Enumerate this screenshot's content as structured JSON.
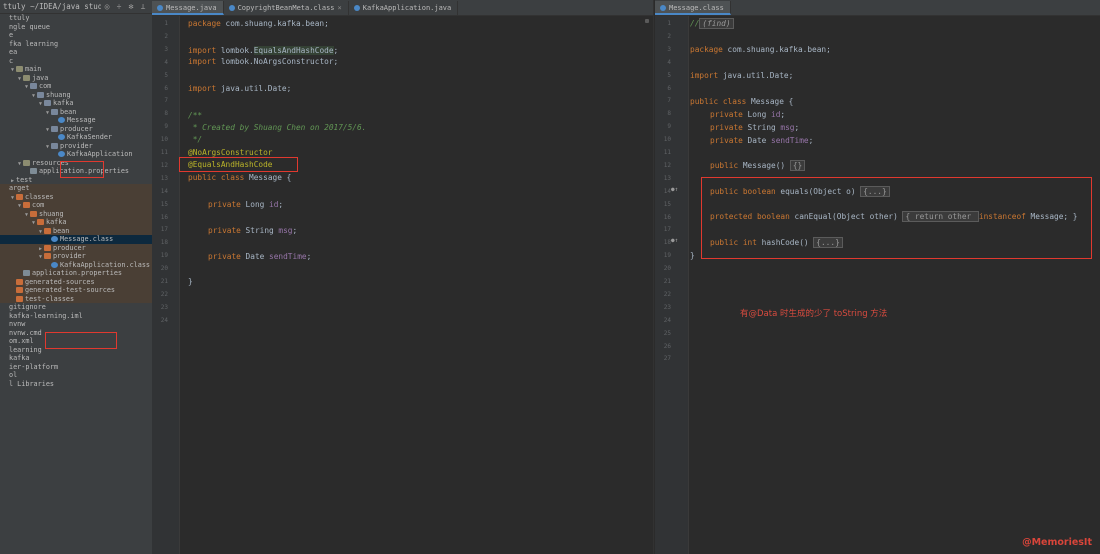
{
  "sidebar": {
    "title": "ttuly ~/IDEA/java study",
    "icons": [
      "globe-icon",
      "divide-icon",
      "gear-icon",
      "minimize-icon"
    ],
    "tree": [
      {
        "label": "ttuly",
        "depth": 0,
        "arrow": "",
        "icon": "",
        "band": false
      },
      {
        "label": "ngle queue",
        "depth": 0,
        "arrow": "",
        "icon": "",
        "band": false
      },
      {
        "label": "e",
        "depth": 0,
        "arrow": "",
        "icon": "",
        "band": false
      },
      {
        "label": "fka learning",
        "depth": 0,
        "arrow": "",
        "icon": "",
        "band": false
      },
      {
        "label": "ea",
        "depth": 0,
        "arrow": "",
        "icon": "",
        "band": false
      },
      {
        "label": "c",
        "depth": 0,
        "arrow": "",
        "icon": "",
        "band": false
      },
      {
        "label": "main",
        "depth": 1,
        "arrow": "▼",
        "icon": "folder",
        "band": false
      },
      {
        "label": "java",
        "depth": 2,
        "arrow": "▼",
        "icon": "folder",
        "band": false
      },
      {
        "label": "com",
        "depth": 3,
        "arrow": "▼",
        "icon": "pkg",
        "band": false
      },
      {
        "label": "shuang",
        "depth": 4,
        "arrow": "▼",
        "icon": "pkg",
        "band": false
      },
      {
        "label": "kafka",
        "depth": 5,
        "arrow": "▼",
        "icon": "pkg",
        "band": false
      },
      {
        "label": "bean",
        "depth": 6,
        "arrow": "▼",
        "icon": "pkg",
        "band": false
      },
      {
        "label": "Message",
        "depth": 7,
        "arrow": "",
        "icon": "class",
        "band": false
      },
      {
        "label": "producer",
        "depth": 6,
        "arrow": "▼",
        "icon": "pkg",
        "band": false
      },
      {
        "label": "KafkaSender",
        "depth": 7,
        "arrow": "",
        "icon": "class",
        "band": false
      },
      {
        "label": "provider",
        "depth": 6,
        "arrow": "▼",
        "icon": "pkg",
        "band": false
      },
      {
        "label": "KafkaApplication",
        "depth": 7,
        "arrow": "",
        "icon": "class",
        "band": false
      },
      {
        "label": "resources",
        "depth": 2,
        "arrow": "▼",
        "icon": "folder",
        "band": false
      },
      {
        "label": "application.properties",
        "depth": 3,
        "arrow": "",
        "icon": "file",
        "band": false
      },
      {
        "label": "test",
        "depth": 1,
        "arrow": "▶",
        "icon": "",
        "band": false
      },
      {
        "label": "arget",
        "depth": 0,
        "arrow": "",
        "icon": "",
        "band": true
      },
      {
        "label": "classes",
        "depth": 1,
        "arrow": "▼",
        "icon": "out",
        "band": true
      },
      {
        "label": "com",
        "depth": 2,
        "arrow": "▼",
        "icon": "out",
        "band": true
      },
      {
        "label": "shuang",
        "depth": 3,
        "arrow": "▼",
        "icon": "out",
        "band": true
      },
      {
        "label": "kafka",
        "depth": 4,
        "arrow": "▼",
        "icon": "out",
        "band": true
      },
      {
        "label": "bean",
        "depth": 5,
        "arrow": "▼",
        "icon": "out",
        "band": true
      },
      {
        "label": "Message.class",
        "depth": 6,
        "arrow": "",
        "icon": "class",
        "band": true,
        "selected": true
      },
      {
        "label": "producer",
        "depth": 5,
        "arrow": "▶",
        "icon": "out",
        "band": true
      },
      {
        "label": "provider",
        "depth": 5,
        "arrow": "▼",
        "icon": "out",
        "band": true
      },
      {
        "label": "KafkaApplication.class",
        "depth": 6,
        "arrow": "",
        "icon": "class",
        "band": true
      },
      {
        "label": "application.properties",
        "depth": 2,
        "arrow": "",
        "icon": "file",
        "band": true
      },
      {
        "label": "generated-sources",
        "depth": 1,
        "arrow": "",
        "icon": "out",
        "band": true
      },
      {
        "label": "generated-test-sources",
        "depth": 1,
        "arrow": "",
        "icon": "out",
        "band": true
      },
      {
        "label": "test-classes",
        "depth": 1,
        "arrow": "",
        "icon": "out",
        "band": true
      },
      {
        "label": "gitignore",
        "depth": 0,
        "arrow": "",
        "icon": "",
        "band": false
      },
      {
        "label": "kafka-learning.iml",
        "depth": 0,
        "arrow": "",
        "icon": "",
        "band": false
      },
      {
        "label": "nvnw",
        "depth": 0,
        "arrow": "",
        "icon": "",
        "band": false
      },
      {
        "label": "nvnw.cmd",
        "depth": 0,
        "arrow": "",
        "icon": "",
        "band": false
      },
      {
        "label": "om.xml",
        "depth": 0,
        "arrow": "",
        "icon": "",
        "band": false
      },
      {
        "label": "learning",
        "depth": 0,
        "arrow": "",
        "icon": "",
        "band": false
      },
      {
        "label": "kafka",
        "depth": 0,
        "arrow": "",
        "icon": "",
        "band": false
      },
      {
        "label": "ier-platform",
        "depth": 0,
        "arrow": "",
        "icon": "",
        "band": false
      },
      {
        "label": "ol",
        "depth": 0,
        "arrow": "",
        "icon": "",
        "band": false
      },
      {
        "label": "l Libraries",
        "depth": 0,
        "arrow": "",
        "icon": "",
        "band": false
      }
    ]
  },
  "left_editor": {
    "tabs": [
      {
        "label": "Message.java",
        "active": true,
        "close": ""
      },
      {
        "label": "CopyrightBeanMeta.class",
        "active": false,
        "close": "×"
      },
      {
        "label": "KafkaApplication.java",
        "active": false,
        "close": ""
      }
    ],
    "line_numbers": [
      "1",
      "2",
      "3",
      "4",
      "5",
      "6",
      "7",
      "8",
      "9",
      "10",
      "11",
      "12",
      "13",
      "14",
      "15",
      "16",
      "17",
      "18",
      "19",
      "20",
      "21",
      "22",
      "23",
      "24"
    ],
    "lines": {
      "l1_kw": "package",
      "l1_rest": " com.shuang.kafka.bean;",
      "l3_kw": "import",
      "l3_rest": " lombok.",
      "l3_hl": "EqualsAndHashCode",
      "l3_end": ";",
      "l4_kw": "import",
      "l4_rest": " lombok.NoArgsConstructor;",
      "l6_kw": "import",
      "l6_rest": " java.util.Date;",
      "l8": "/**",
      "l9": " * Created by Shuang Chen on 2017/5/6.",
      "l10": " */",
      "l11": "@NoArgsConstructor",
      "l12": "@EqualsAndHashCode",
      "l13_kw": "public class",
      "l13_rest": " Message {",
      "l15_kw": "private",
      "l15_rest": " Long ",
      "l15_fld": "id",
      "l17_kw": "private",
      "l17_rest": " String ",
      "l17_fld": "msg",
      "l19_kw": "private",
      "l19_rest": " Date ",
      "l19_fld": "sendTime",
      "l21": "}"
    }
  },
  "right_editor": {
    "tabs": [
      {
        "label": "Message.class",
        "active": true,
        "close": ""
      }
    ],
    "line_numbers": [
      "1",
      "2",
      "3",
      "4",
      "5",
      "6",
      "7",
      "8",
      "9",
      "10",
      "11",
      "12",
      "13",
      "14",
      "15",
      "16",
      "17",
      "18",
      "19",
      "20",
      "21",
      "22",
      "23",
      "24",
      "25",
      "26",
      "27"
    ],
    "lines": {
      "l1": "//",
      "l1b": "(find)",
      "r_pkg_kw": "package",
      "r_pkg_rest": " com.shuang.kafka.bean;",
      "r_imp_kw": "import",
      "r_imp_rest": " java.util.Date;",
      "r_cls_kw": "public class",
      "r_cls_rest": " Message {",
      "r_f1_kw": "private",
      "r_f1_rest": " Long ",
      "r_f1_fld": "id",
      "r_f2_kw": "private",
      "r_f2_rest": " String ",
      "r_f2_fld": "msg",
      "r_f3_kw": "private",
      "r_f3_rest": " Date ",
      "r_f3_fld": "sendTime",
      "r_ctor_kw": "public",
      "r_ctor_rest": " Message() ",
      "r_ctor_fold": "{}",
      "r_eq_kw": "public boolean",
      "r_eq_rest": " equals(Object o) ",
      "r_eq_fold": "{...}",
      "r_can_kw": "protected boolean",
      "r_can_rest": " canEqual(Object other) ",
      "r_can_mid": "{ return other ",
      "r_can_kw2": "instanceof",
      "r_can_end": " Message; }",
      "r_hash_kw": "public int",
      "r_hash_rest": " hashCode() ",
      "r_hash_fold": "{...}",
      "r_close": "}"
    }
  },
  "annotation_text": "有@Data 时生成的少了 toString 方法",
  "watermark": "@MemoriesIt",
  "colors": {
    "annotation_red": "#e0392f",
    "accent_blue": "#4a88c7"
  }
}
